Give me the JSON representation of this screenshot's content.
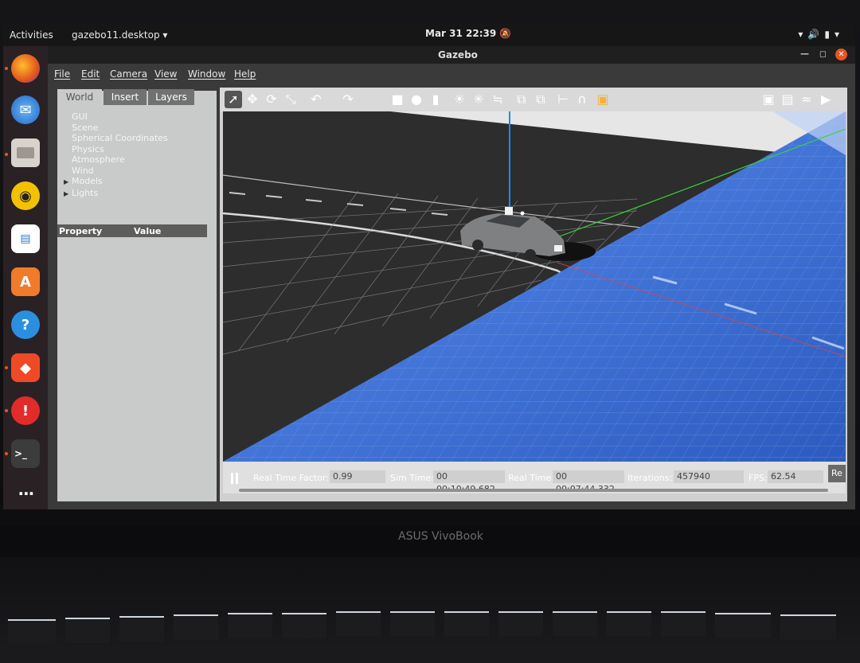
{
  "topbar": {
    "activities": "Activities",
    "app_menu": "gazebo11.desktop ▾",
    "clock": "Mar 31  22:39",
    "tray_icons": [
      "wifi-icon",
      "volume-icon",
      "battery-icon",
      "power-menu-icon"
    ]
  },
  "dock": {
    "items": [
      "firefox-icon",
      "thunderbird-icon",
      "files-icon",
      "rhythmbox-icon",
      "writer-icon",
      "software-icon",
      "help-icon",
      "anydesk-icon",
      "error-report-icon",
      "terminal-icon",
      "app-grid-icon"
    ]
  },
  "window": {
    "title": "Gazebo",
    "menu": [
      "File",
      "Edit",
      "Camera",
      "View",
      "Window",
      "Help"
    ]
  },
  "left_panel": {
    "tabs": [
      "World",
      "Insert",
      "Layers"
    ],
    "tree": [
      {
        "label": "GUI",
        "expandable": false
      },
      {
        "label": "Scene",
        "expandable": false
      },
      {
        "label": "Spherical Coordinates",
        "expandable": false
      },
      {
        "label": "Physics",
        "expandable": false
      },
      {
        "label": "Atmosphere",
        "expandable": false
      },
      {
        "label": "Wind",
        "expandable": false
      },
      {
        "label": "Models",
        "expandable": true
      },
      {
        "label": "Lights",
        "expandable": true
      }
    ],
    "property_header": "Property",
    "value_header": "Value"
  },
  "status": {
    "rtf_label": "Real Time Factor:",
    "rtf_value": "0.99",
    "sim_label": "Sim Time:",
    "sim_value": "00 00:10:49.682",
    "real_label": "Real Time:",
    "real_value": "00 00:07:44.332",
    "iter_label": "Iterations:",
    "iter_value": "457940",
    "fps_label": "FPS:",
    "fps_value": "62.54",
    "reset_label": "Re"
  },
  "laptop": {
    "brand": "ASUS VivoBook"
  },
  "colors": {
    "ubuntu_orange": "#e95420",
    "ground_blue": "#3f74d8"
  }
}
